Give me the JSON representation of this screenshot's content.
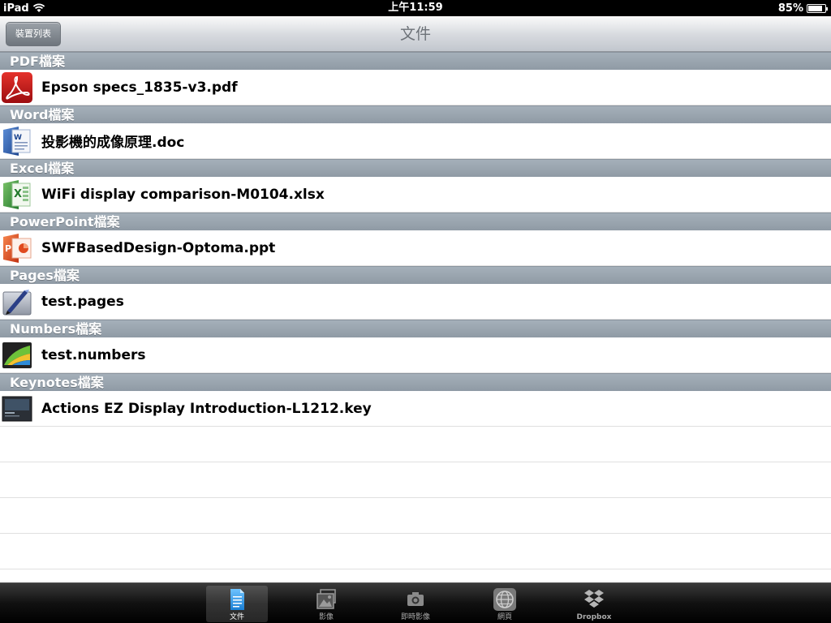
{
  "status": {
    "device": "iPad",
    "time": "上午11:59",
    "battery": "85%",
    "battery_level": 0.85
  },
  "nav": {
    "back_label": "裝置列表",
    "title": "文件"
  },
  "sections": [
    {
      "header": "PDF檔案",
      "file": "Epson specs_1835-v3.pdf",
      "icon": "pdf-icon"
    },
    {
      "header": "Word檔案",
      "file": "投影機的成像原理.doc",
      "icon": "word-icon"
    },
    {
      "header": "Excel檔案",
      "file": "WiFi display comparison-M0104.xlsx",
      "icon": "excel-icon"
    },
    {
      "header": "PowerPoint檔案",
      "file": "SWFBasedDesign-Optoma.ppt",
      "icon": "powerpoint-icon"
    },
    {
      "header": "Pages檔案",
      "file": "test.pages",
      "icon": "pages-icon"
    },
    {
      "header": "Numbers檔案",
      "file": "test.numbers",
      "icon": "numbers-icon"
    },
    {
      "header": "Keynotes檔案",
      "file": "Actions EZ Display Introduction-L1212.key",
      "icon": "keynote-icon"
    }
  ],
  "tabs": [
    {
      "label": "文件",
      "icon": "document-icon",
      "selected": true
    },
    {
      "label": "影像",
      "icon": "photos-icon",
      "selected": false
    },
    {
      "label": "即時影像",
      "icon": "camera-icon",
      "selected": false
    },
    {
      "label": "網頁",
      "icon": "globe-icon",
      "selected": false
    },
    {
      "label": "Dropbox",
      "icon": "dropbox-icon",
      "selected": false
    }
  ],
  "colors": {
    "section_header": "#97a2ad",
    "nav_title": "#6d7278",
    "pdf": "#c4161c",
    "word": "#2b5797",
    "excel": "#2e8b3a",
    "powerpoint": "#e04a1f"
  }
}
